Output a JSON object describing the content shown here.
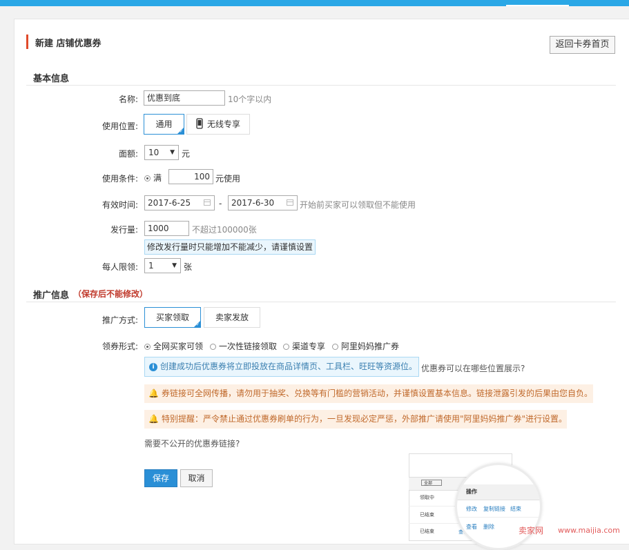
{
  "header": {
    "title": "新建 店铺优惠券",
    "back_button": "返回卡券首页"
  },
  "basic": {
    "section_title": "基本信息",
    "name": {
      "label": "名称:",
      "value": "优惠到底",
      "hint": "10个字以内"
    },
    "position": {
      "label": "使用位置:",
      "option_general": "通用",
      "option_wireless": "无线专享"
    },
    "denomination": {
      "label": "面额:",
      "value": "10",
      "unit": "元"
    },
    "condition": {
      "label": "使用条件:",
      "prefix": "满",
      "value": "100",
      "suffix": "元使用"
    },
    "validity": {
      "label": "有效时间:",
      "start": "2017-6-25",
      "sep": "-",
      "end": "2017-6-30",
      "hint": "开始前买家可以领取但不能使用"
    },
    "quantity": {
      "label": "发行量:",
      "value": "1000",
      "hint": "不超过100000张",
      "tip": "修改发行量时只能增加不能减少，请谨慎设置"
    },
    "limit": {
      "label": "每人限领:",
      "value": "1",
      "unit": "张"
    }
  },
  "promo": {
    "section_title": "推广信息",
    "section_note": "（保存后不能修改）",
    "method": {
      "label": "推广方式:",
      "option_buyer": "买家领取",
      "option_seller": "卖家发放"
    },
    "form": {
      "label": "领券形式:",
      "options": [
        "全网买家可领",
        "一次性链接领取",
        "渠道专享",
        "阿里妈妈推广券"
      ]
    },
    "info_tip": "创建成功后优惠券将立即投放在商品详情页、工具栏、旺旺等资源位。",
    "info_link": "优惠券可以在哪些位置展示?",
    "warn1": "券链接可全网传播，请勿用于抽奖、兑换等有门槛的营销活动，并谨慎设置基本信息。链接泄露引发的后果由您自负。",
    "warn2": "特别提醒：严令禁止通过优惠券刷单的行为，一旦发现必定严惩，外部推广请使用\"阿里妈妈推广券\"进行设置。",
    "private_link": "需要不公开的优惠券链接?"
  },
  "actions": {
    "save": "保存",
    "cancel": "取消"
  },
  "preview": {
    "filter": "全部",
    "rows": [
      "领取中",
      "已结束",
      "已结束",
      "已结束"
    ],
    "mag_header": "操作",
    "mag_links1": [
      "修改",
      "复制链接",
      "结束"
    ],
    "mag_links2": [
      "查看",
      "删除"
    ],
    "small_link": "查看"
  },
  "watermark": {
    "brand": "卖家网",
    "url": "www.maijia.com"
  }
}
